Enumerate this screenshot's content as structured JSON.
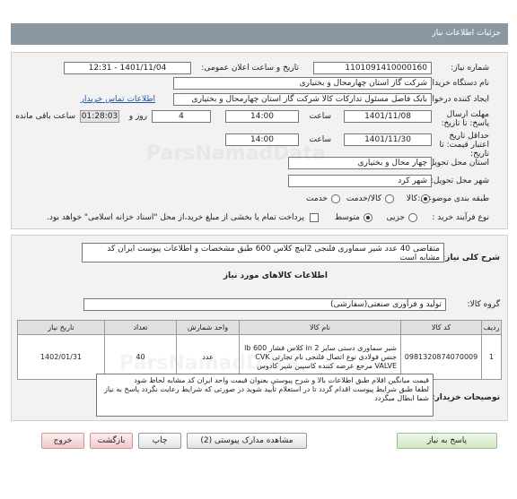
{
  "header": {
    "title": "جزئیات اطلاعات نیاز"
  },
  "fields": {
    "need_number_label": "شماره نیاز:",
    "need_number": "1101091410000160",
    "announce_label": "تاریخ و ساعت اعلان عمومی:",
    "announce_value": "1401/11/04 - 12:31",
    "buyer_label": "نام دستگاه خریدار:",
    "buyer_value": "شرکت گاز استان چهارمحال و بختیاری",
    "creator_label": "ایجاد کننده درخواست:",
    "creator_value": "بابک فاضل  مسئول تدارکات کالا شرکت گاز استان چهارمحال و بختیاری",
    "contact_link": "اطلاعات تماس خریدار",
    "deadline_label": "مهلت ارسال پاسخ: تا تاریخ:",
    "deadline_date": "1401/11/08",
    "time_label": "ساعت",
    "deadline_time": "14:00",
    "days_value": "4",
    "days_label": "روز و",
    "remaining_time": "01:28:03",
    "remaining_label": "ساعت باقی مانده",
    "validity_label": "حداقل تاریخ اعتبار قیمت: تا تاریخ:",
    "validity_date": "1401/11/30",
    "validity_time": "14:00",
    "province_label": "استان محل تحویل:",
    "province_value": "چهار محال و بختیاری",
    "city_label": "شهر محل تحویل:",
    "city_value": "شهر کرد",
    "category_label": "طبقه بندی موضوعی:",
    "category_options": [
      "کالا",
      "کالا/خدمت",
      "خدمت"
    ],
    "purchase_label": "نوع فرآیند خرید :",
    "purchase_options": [
      "جزیی",
      "متوسط"
    ],
    "payment_note": "پرداخت تمام یا بخشی از مبلغ خرید،از محل \"اسناد خزانه اسلامی\" خواهد بود."
  },
  "summary": {
    "label": "شرح کلی نیاز:",
    "text": "متقاضی 40 عدد شیر سماوری فلنجی 2اینچ کلاس 600 طبق مشخصات و اطلاعات پیوست ایران کد مشابه است"
  },
  "goods_info_title": "اطلاعات کالاهای مورد نیاز",
  "goods_group_label": "گروه کالا:",
  "goods_group_value": "تولید و فرآوری صنعتی(سفارشی)",
  "table": {
    "headers": [
      "ردیف",
      "کد کالا",
      "نام کالا",
      "واحد شمارش",
      "تعداد",
      "تاریخ نیاز"
    ],
    "rows": [
      {
        "row": "1",
        "code": "0981320874070009",
        "name": "شیر سماوری دستی سایز 2 in کلاس فشار lb 600 جنس فولادی نوع اتصال فلنجی نام تجارتی CVK VALVE مرجع عرضه کننده کاسپین شیر کادوس",
        "unit": "عدد",
        "qty": "40",
        "date": "1402/01/31"
      }
    ]
  },
  "buyer_notes": {
    "label": "توضیحات خریدار:",
    "text": "قیمت میانگین اقلام طبق  اطلاعات بالا و شرح پیوستی بعنوان قیمت واحد  ایران کد مشابه  لحاظ شود\nلطفا طبق شرایط پیوست اقدام گردد   تا در استعلام تأیید شوید در صورتی که شرایط رعایت نگردد پاسخ به نیاز شما ابطال میگردد"
  },
  "buttons": {
    "reply": "پاسخ به نیاز",
    "attachments": "مشاهده مدارک پیوستی (2)",
    "print": "چاپ",
    "back": "بازگشت",
    "exit": "خروج"
  },
  "watermark": {
    "text": "ParsNamadData"
  }
}
